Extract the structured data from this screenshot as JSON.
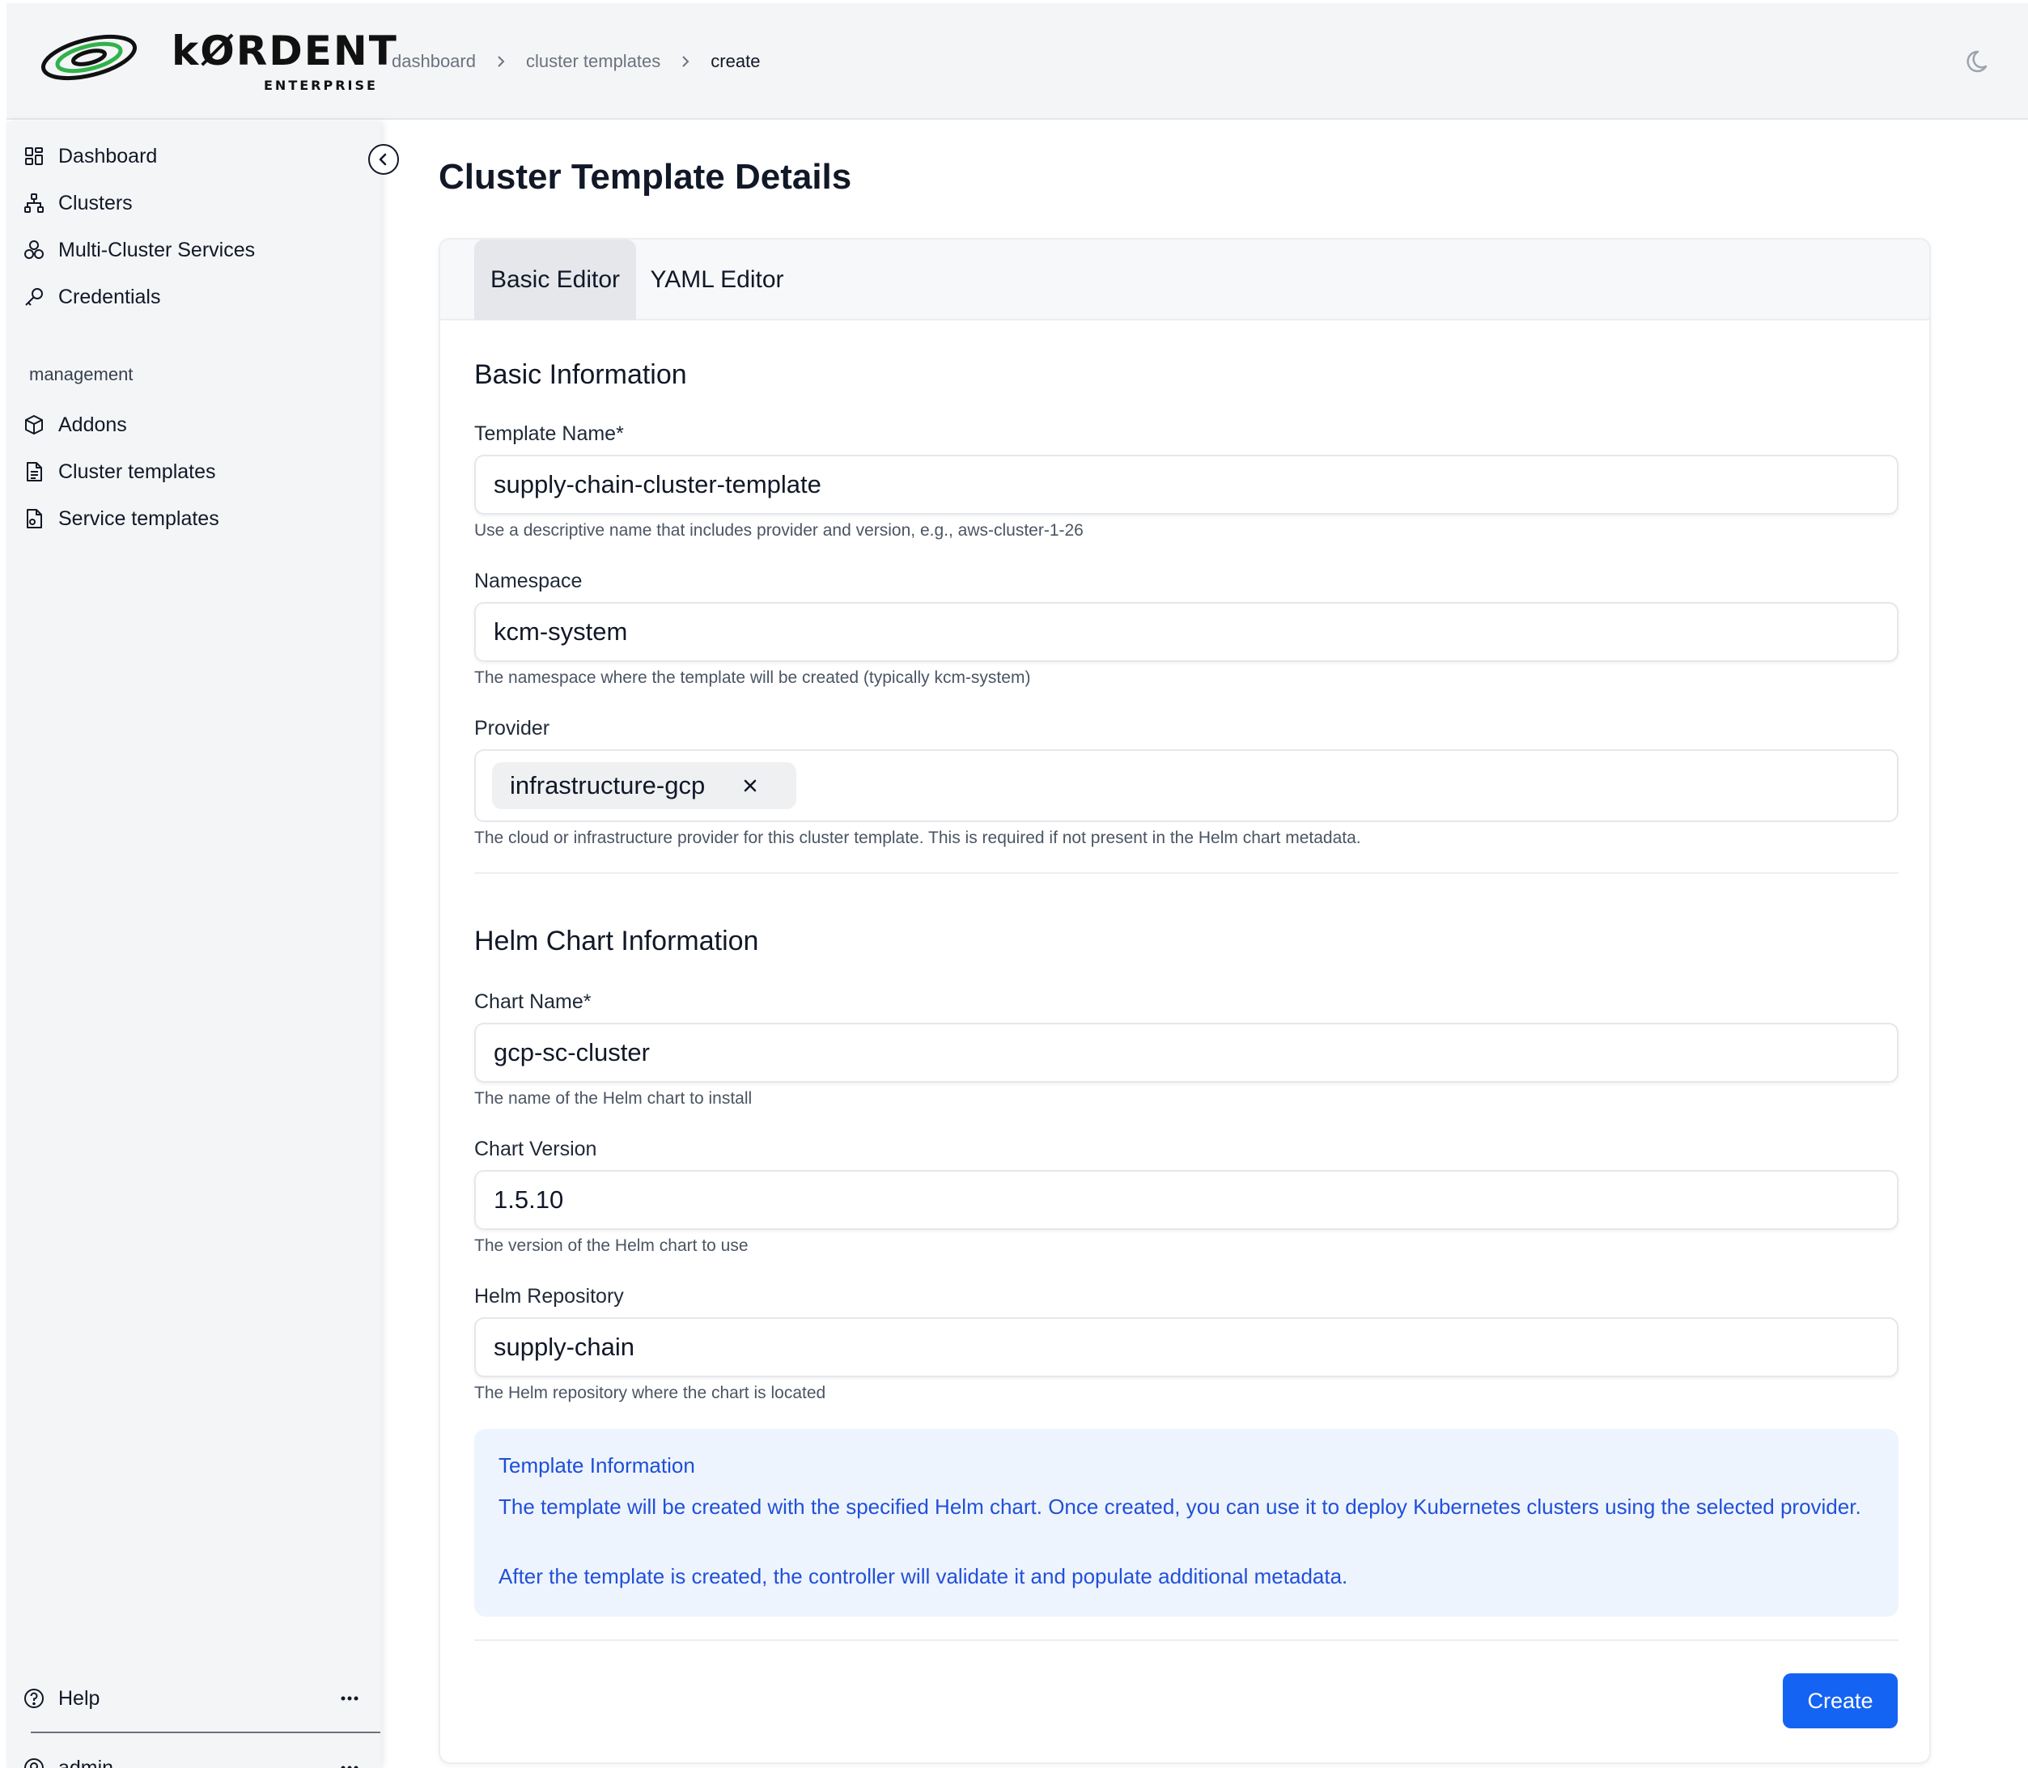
{
  "brand": {
    "name": "kØRDENT",
    "subtitle": "ENTERPRISE",
    "logo_icon": "kordent-orbit-logo"
  },
  "breadcrumb": [
    "dashboard",
    "cluster templates",
    "create"
  ],
  "header": {
    "theme_icon": "moon-icon"
  },
  "sidebar": {
    "items": [
      {
        "label": "Dashboard",
        "icon": "dashboard-grid-icon"
      },
      {
        "label": "Clusters",
        "icon": "cluster-network-icon"
      },
      {
        "label": "Multi-Cluster Services",
        "icon": "multi-cluster-icon"
      },
      {
        "label": "Credentials",
        "icon": "key-icon"
      }
    ],
    "group_label": "management",
    "management_items": [
      {
        "label": "Addons",
        "icon": "package-icon"
      },
      {
        "label": "Cluster templates",
        "icon": "file-text-icon"
      },
      {
        "label": "Service templates",
        "icon": "file-gear-icon"
      }
    ],
    "help_label": "Help",
    "user_label": "admin"
  },
  "main": {
    "title": "Cluster Template Details",
    "tabs": [
      {
        "label": "Basic Editor",
        "active": true
      },
      {
        "label": "YAML Editor",
        "active": false
      }
    ],
    "basic_section_title": "Basic Information",
    "fields": {
      "template_name": {
        "label": "Template Name*",
        "value": "supply-chain-cluster-template",
        "hint": "Use a descriptive name that includes provider and version, e.g., aws-cluster-1-26"
      },
      "namespace": {
        "label": "Namespace",
        "value": "kcm-system",
        "hint": "The namespace where the template will be created (typically kcm-system)"
      },
      "provider": {
        "label": "Provider",
        "tags": [
          "infrastructure-gcp"
        ],
        "hint": "The cloud or infrastructure provider for this cluster template. This is required if not present in the Helm chart metadata."
      },
      "chart_name": {
        "label": "Chart Name*",
        "value": "gcp-sc-cluster",
        "hint": "The name of the Helm chart to install"
      },
      "chart_version": {
        "label": "Chart Version",
        "value": "1.5.10",
        "hint": "The version of the Helm chart to use"
      },
      "helm_repository": {
        "label": "Helm Repository",
        "value": "supply-chain",
        "hint": "The Helm repository where the chart is located"
      }
    },
    "helm_section_title": "Helm Chart Information",
    "info": {
      "title": "Template Information",
      "line1": "The template will be created with the specified Helm chart. Once created, you can use it to deploy Kubernetes clusters using the selected provider.",
      "line2": "After the template is created, the controller will validate it and populate additional metadata."
    },
    "create_label": "Create"
  },
  "colors": {
    "primary": "#1463f3",
    "info_bg": "#eef4fd",
    "info_text": "#2150d9",
    "logo_green": "#2fb34a"
  }
}
